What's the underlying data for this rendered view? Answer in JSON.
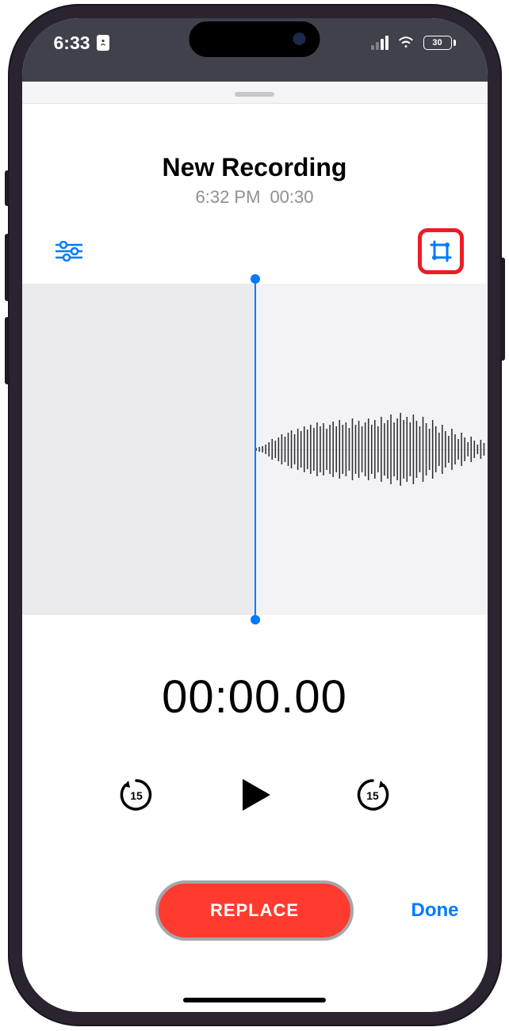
{
  "status": {
    "time": "6:33",
    "battery_pct": "30"
  },
  "header": {
    "title": "New Recording",
    "subtitle_time": "6:32 PM",
    "subtitle_duration": "00:30"
  },
  "timecode": "00:00.00",
  "controls": {
    "skip_back_seconds": "15",
    "skip_forward_seconds": "15"
  },
  "buttons": {
    "replace": "REPLACE",
    "done": "Done"
  },
  "icons": {
    "settings": "settings-sliders",
    "trim": "trim-crop"
  },
  "colors": {
    "accent": "#007aff",
    "record": "#ff3b30",
    "highlight": "#ec1c24"
  }
}
